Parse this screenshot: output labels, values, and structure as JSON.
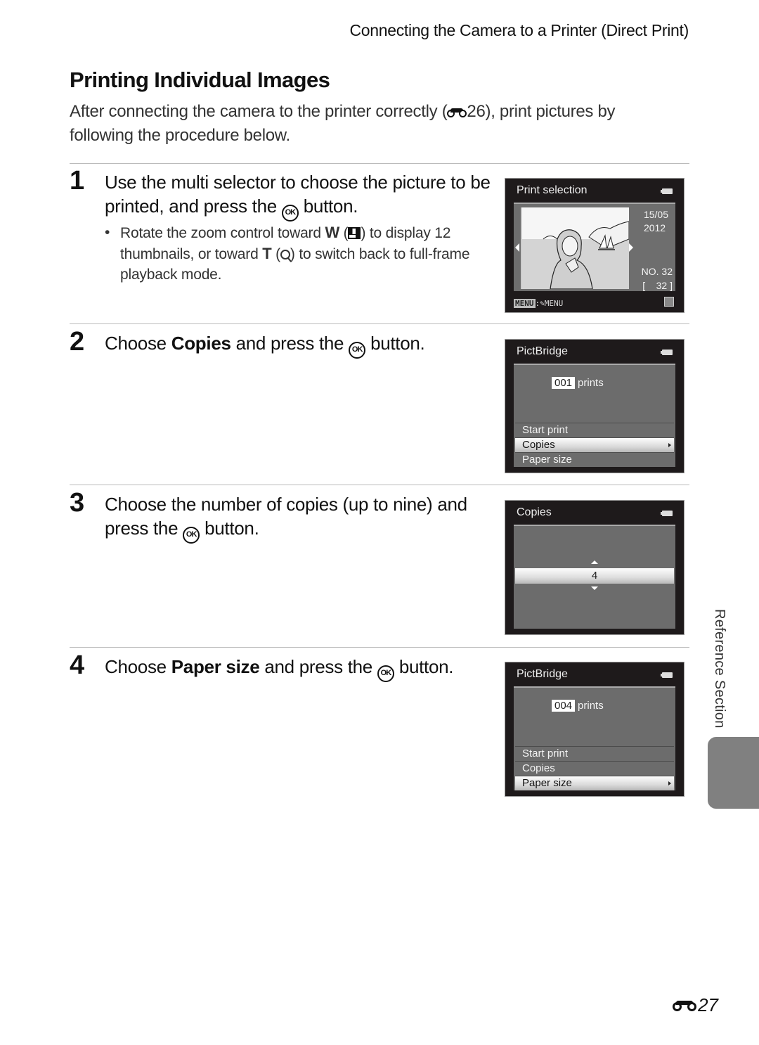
{
  "header": {
    "running_title": "Connecting the Camera to a Printer (Direct Print)"
  },
  "page_title": "Printing Individual Images",
  "intro": {
    "before_ref": "After connecting the camera to the printer correctly (",
    "ref_page": "26",
    "after_ref": "), print pictures by following the procedure below."
  },
  "steps": [
    {
      "number": "1",
      "text_a": "Use the multi selector to choose the picture to be printed, and press the ",
      "ok_label": "OK",
      "text_b": " button.",
      "bullet": {
        "a": "Rotate the zoom control toward ",
        "w": "W",
        "b": " (",
        "c": ") to display 12 thumbnails, or toward ",
        "t": "T",
        "d": " (",
        "e": ") to switch back to full-frame playback mode."
      }
    },
    {
      "number": "2",
      "text_a": "Choose ",
      "bold": "Copies",
      "text_b": " and press the ",
      "ok_label": "OK",
      "text_c": " button."
    },
    {
      "number": "3",
      "text_a": "Choose the number of copies (up to nine) and press the ",
      "ok_label": "OK",
      "text_b": " button."
    },
    {
      "number": "4",
      "text_a": "Choose ",
      "bold": "Paper size",
      "text_b": " and press the ",
      "ok_label": "OK",
      "text_c": " button."
    }
  ],
  "screens": {
    "print_selection": {
      "title": "Print selection",
      "date_line1": "15/05",
      "date_line2": "2012",
      "file_no": "NO. 32",
      "frame_count": "[    32 ]",
      "menu_hint_key": "MENU",
      "menu_hint_sep": ":",
      "menu_hint_target": "✎MENU"
    },
    "pictbridge_1": {
      "title": "PictBridge",
      "count": "001",
      "count_unit": "prints",
      "items": [
        "Start print",
        "Copies",
        "Paper size"
      ],
      "selected": "Copies"
    },
    "copies": {
      "title": "Copies",
      "value": "4"
    },
    "pictbridge_2": {
      "title": "PictBridge",
      "count": "004",
      "count_unit": "prints",
      "items": [
        "Start print",
        "Copies",
        "Paper size"
      ],
      "selected": "Paper size"
    }
  },
  "side_tab": {
    "label": "Reference Section"
  },
  "footer": {
    "page_number": "27"
  }
}
